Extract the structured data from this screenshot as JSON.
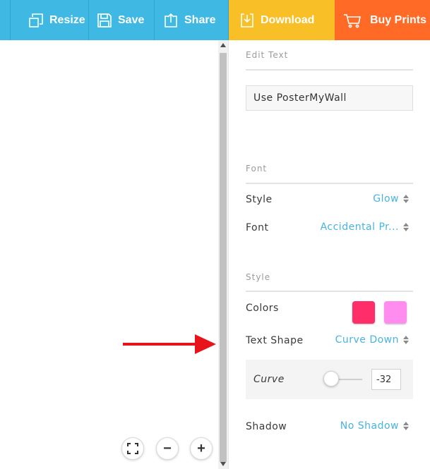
{
  "toolbar": {
    "resize_label": "Resize",
    "save_label": "Save",
    "share_label": "Share",
    "download_label": "Download",
    "buy_prints_label": "Buy Prints"
  },
  "zoom": {
    "fit_icon": "fullscreen-icon",
    "zoom_out_label": "−",
    "zoom_in_label": "+"
  },
  "panel": {
    "edit_text": {
      "title": "Edit Text",
      "input_value": "Use PosterMyWall"
    },
    "font": {
      "title": "Font",
      "style_label": "Style",
      "style_value": "Glow",
      "font_label": "Font",
      "font_value": "Accidental Pr..."
    },
    "style": {
      "title": "Style",
      "colors_label": "Colors",
      "color_1": "#ff2d6a",
      "color_2": "#ff8df0",
      "text_shape_label": "Text Shape",
      "text_shape_value": "Curve Down",
      "curve_label": "Curve",
      "curve_value": "-32",
      "shadow_label": "Shadow",
      "shadow_value": "No Shadow"
    }
  },
  "colors": {
    "toolbar_blue": "#3fb8e3",
    "download_yellow": "#f8bf27",
    "buy_orange": "#ff6a26",
    "link_blue": "#47b3e2",
    "arrow_red": "#e8141b"
  }
}
